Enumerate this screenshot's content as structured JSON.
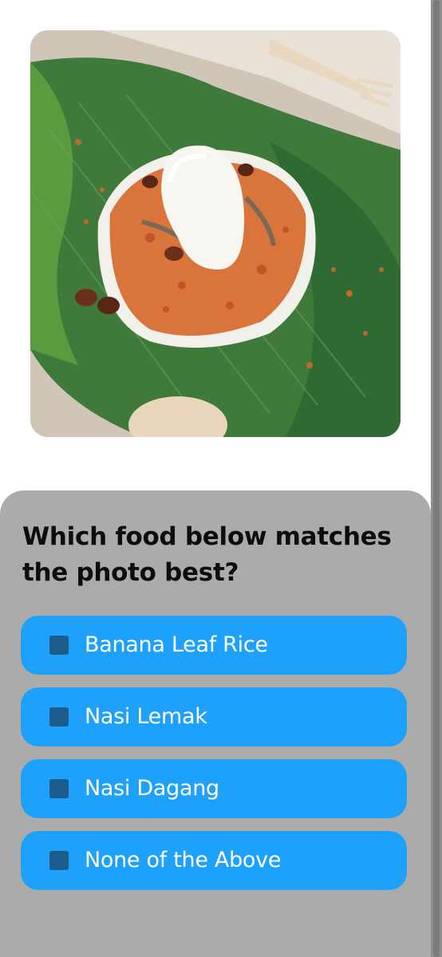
{
  "photo": {
    "icon": "food-photo"
  },
  "quiz": {
    "question": "Which food below matches the photo best?",
    "options": [
      {
        "label": "Banana Leaf Rice"
      },
      {
        "label": "Nasi Lemak"
      },
      {
        "label": "Nasi Dagang"
      },
      {
        "label": "None of the Above"
      }
    ]
  },
  "colors": {
    "panel": "#ababab",
    "option": "#1ea1fa",
    "checkbox": "#1d5c8d",
    "question_text": "#0d0d0d"
  }
}
